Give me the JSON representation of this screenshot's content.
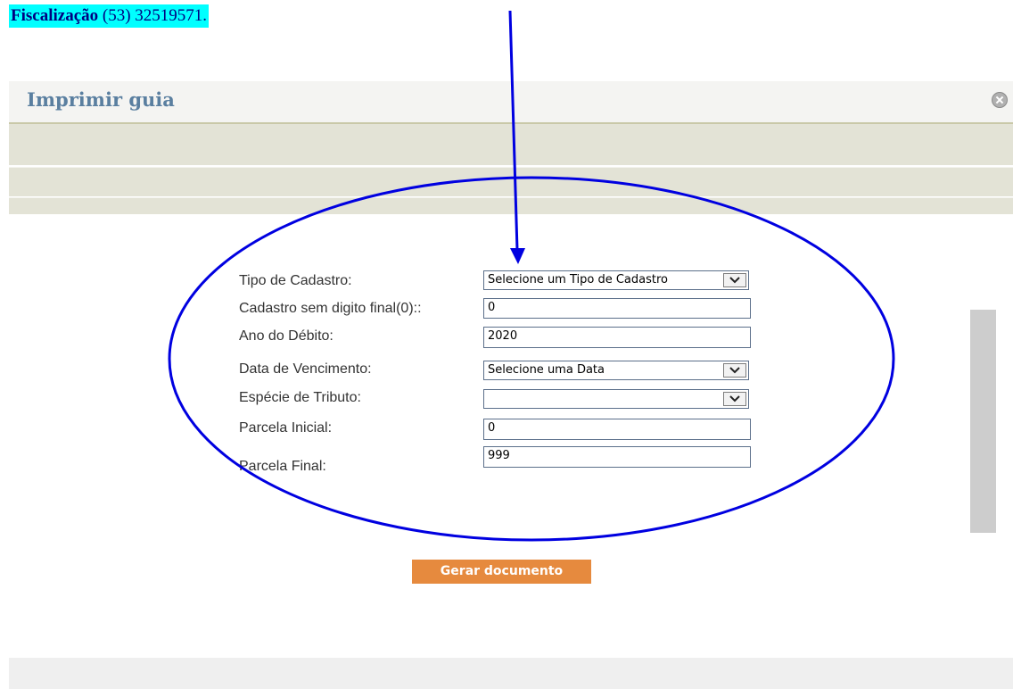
{
  "header_note": {
    "bold": "Fiscalização",
    "rest": " (53) 32519571."
  },
  "dialog": {
    "title": "Imprimir guia"
  },
  "form": {
    "tipo_cadastro": {
      "label": "Tipo de Cadastro:",
      "value": "Selecione um Tipo de Cadastro"
    },
    "cadastro": {
      "label": "Cadastro sem digito final(0)::",
      "value": "0"
    },
    "ano": {
      "label": "Ano do Débito:",
      "value": "2020"
    },
    "data_vencimento": {
      "label": "Data de Vencimento:",
      "value": "Selecione uma Data"
    },
    "especie": {
      "label": "Espécie de Tributo:",
      "value": ""
    },
    "parcela_inicial": {
      "label": "Parcela Inicial:",
      "value": "0"
    },
    "parcela_final": {
      "label": "Parcela Final:",
      "value": "999"
    }
  },
  "actions": {
    "generate_label": "Gerar documento"
  },
  "annotation": {
    "color": "#0000e0"
  },
  "icons": {
    "close": "close-icon",
    "dropdown": "chevron-down-icon"
  }
}
